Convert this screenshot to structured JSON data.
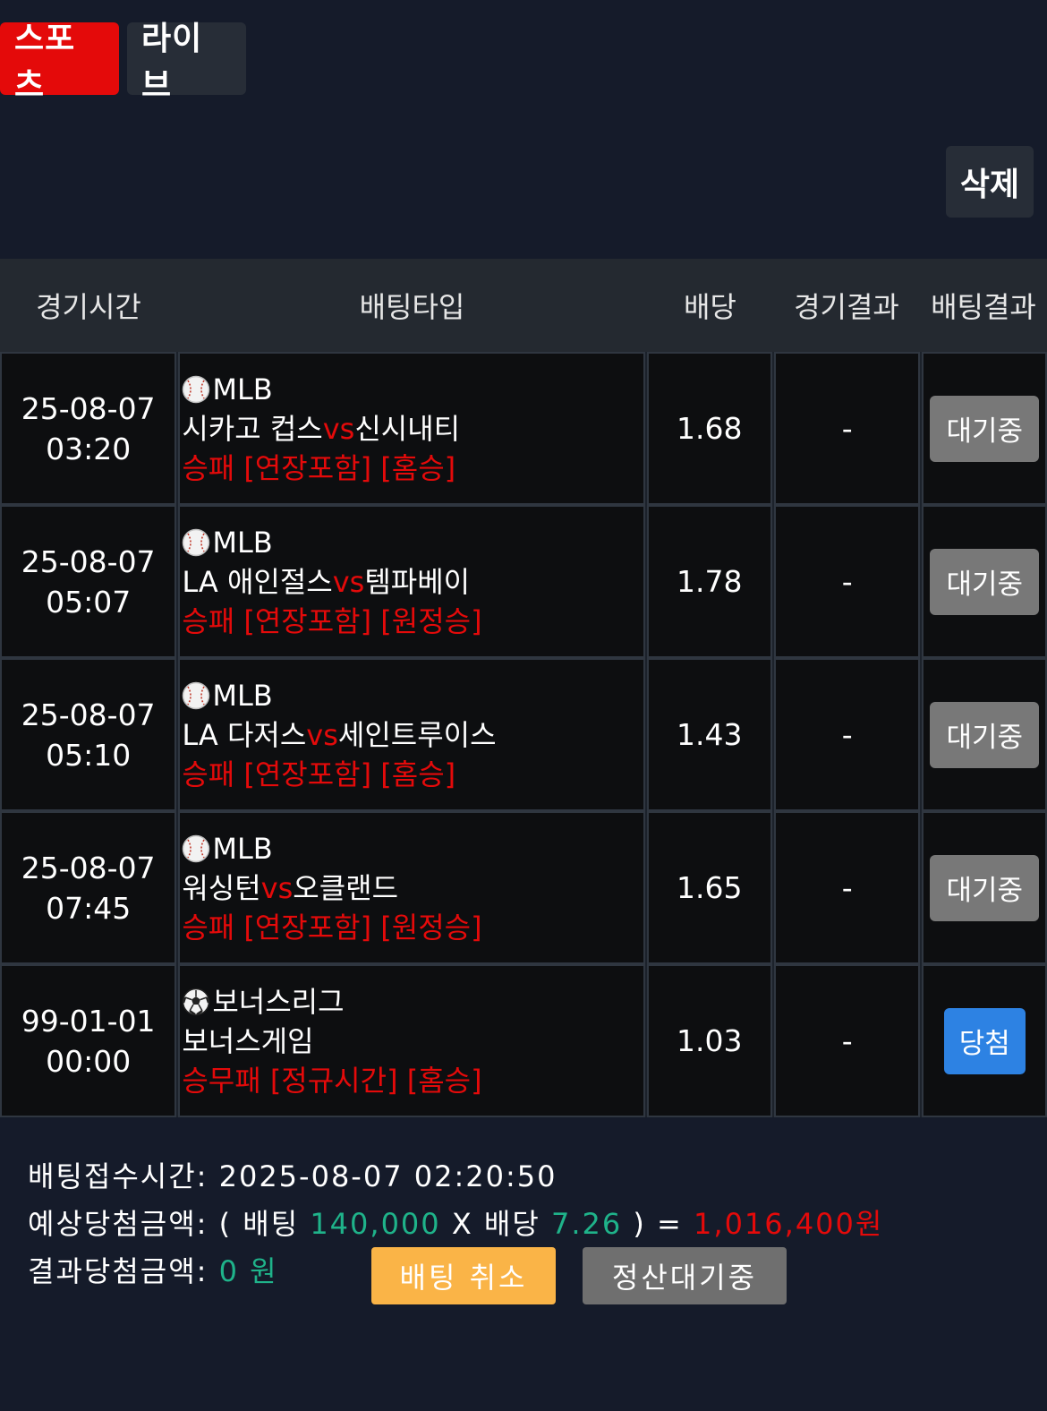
{
  "tabs": [
    {
      "label": "스포츠",
      "active": true
    },
    {
      "label": "라이브",
      "active": false
    }
  ],
  "delete_label": "삭제",
  "headers": [
    "경기시간",
    "배팅타입",
    "배당",
    "경기결과",
    "배팅결과"
  ],
  "rows": [
    {
      "date": "25-08-07",
      "time": "03:20",
      "sport_icon": "baseball-icon",
      "league": "MLB",
      "home": "시카고 컵스",
      "vs": "vs",
      "away": "신시내티",
      "bet": "승패 [연장포함] [홈승]",
      "odds": "1.68",
      "result": "-",
      "status": "대기중"
    },
    {
      "date": "25-08-07",
      "time": "05:07",
      "sport_icon": "baseball-icon",
      "league": "MLB",
      "home": "LA 애인절스",
      "vs": "vs",
      "away": "템파베이",
      "bet": "승패 [연장포함] [원정승]",
      "odds": "1.78",
      "result": "-",
      "status": "대기중"
    },
    {
      "date": "25-08-07",
      "time": "05:10",
      "sport_icon": "baseball-icon",
      "league": "MLB",
      "home": "LA 다저스",
      "vs": "vs",
      "away": "세인트루이스",
      "bet": "승패 [연장포함] [홈승]",
      "odds": "1.43",
      "result": "-",
      "status": "대기중"
    },
    {
      "date": "25-08-07",
      "time": "07:45",
      "sport_icon": "baseball-icon",
      "league": "MLB",
      "home": "워싱턴",
      "vs": "vs",
      "away": "오클랜드",
      "bet": "승패 [연장포함] [원정승]",
      "odds": "1.65",
      "result": "-",
      "status": "대기중"
    },
    {
      "date": "99-01-01",
      "time": "00:00",
      "sport_icon": "soccer-ball-icon",
      "league": "보너스리그",
      "home": "보너스게임",
      "vs": "",
      "away": "",
      "bet": "승무패 [정규시간] [홈승]",
      "odds": "1.03",
      "result": "-",
      "status": "당첨"
    }
  ],
  "summary": {
    "bet_time_label": "배팅접수시간:",
    "bet_time": "2025-08-07 02:20:50",
    "expected_label": "예상당첨금액:",
    "open_paren": "(",
    "bet_word": "배팅",
    "bet_amount": "140,000",
    "x": "X",
    "odds_word": "배당",
    "total_odds": "7.26",
    "close_eq": ") =",
    "expected_amount": "1,016,400원",
    "result_label": "결과당첨금액:",
    "result_amount": "0",
    "result_unit": "원"
  },
  "cancel_label": "배팅 취소",
  "pending_label": "정산대기중",
  "colors": {
    "accent_red": "#e40a0a",
    "green": "#1fb38a",
    "orange": "#fab447",
    "blue": "#2d82e3"
  }
}
